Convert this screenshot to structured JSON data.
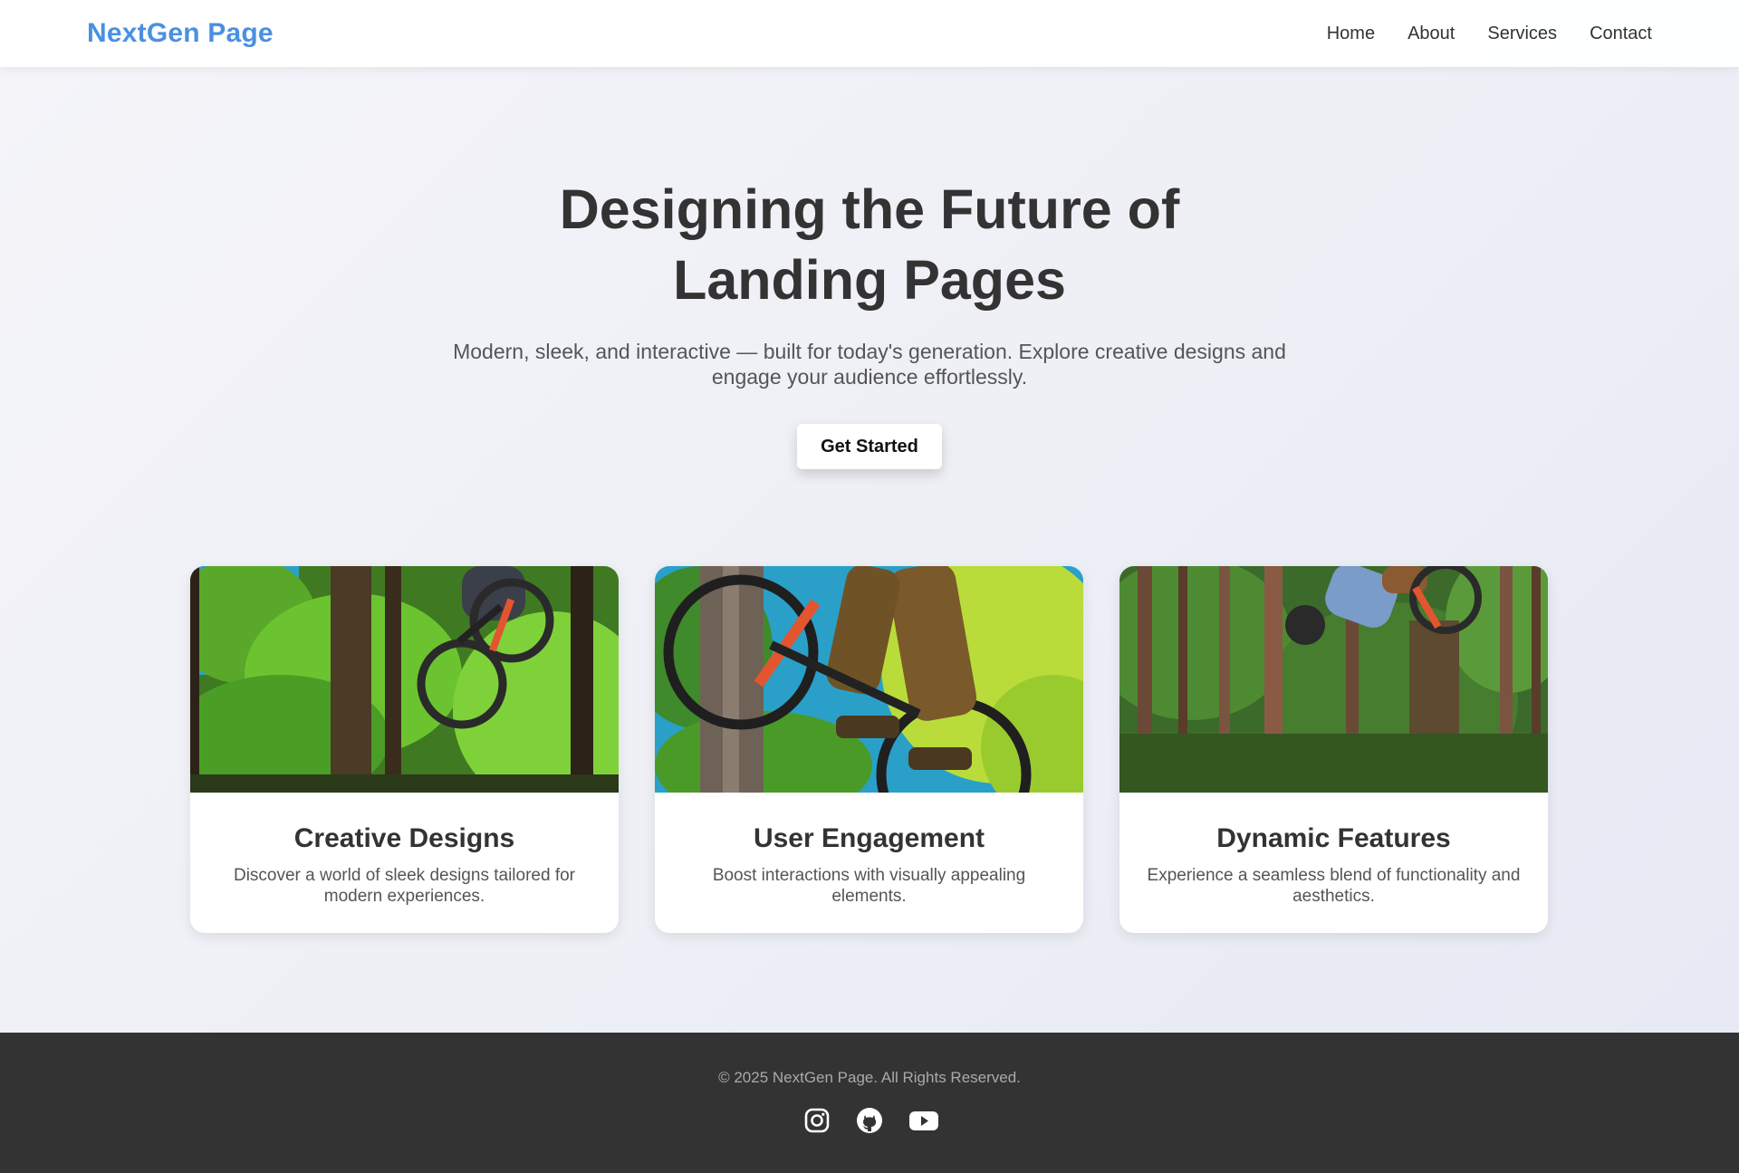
{
  "navbar": {
    "logo": "NextGen Page",
    "links": [
      "Home",
      "About",
      "Services",
      "Contact"
    ]
  },
  "hero": {
    "title": "Designing the Future of Landing Pages",
    "subtitle": "Modern, sleek, and interactive — built for today's generation. Explore creative designs and engage your audience effortlessly.",
    "cta_label": "Get Started"
  },
  "cards": [
    {
      "title": "Creative Designs",
      "description": "Discover a world of sleek designs tailored for modern experiences.",
      "image": "mountain-biker-jump-forest-photo"
    },
    {
      "title": "User Engagement",
      "description": "Boost interactions with visually appealing elements.",
      "image": "mountain-biker-closeup-forest-photo"
    },
    {
      "title": "Dynamic Features",
      "description": "Experience a seamless blend of functionality and aesthetics.",
      "image": "mountain-biker-airborne-forest-photo"
    }
  ],
  "footer": {
    "copyright": "© 2025 NextGen Page. All Rights Reserved.",
    "socials": [
      "instagram-icon",
      "github-icon",
      "youtube-icon"
    ]
  },
  "colors": {
    "brand": "#4a90e2",
    "footer_bg": "#333333",
    "text": "#333333"
  }
}
